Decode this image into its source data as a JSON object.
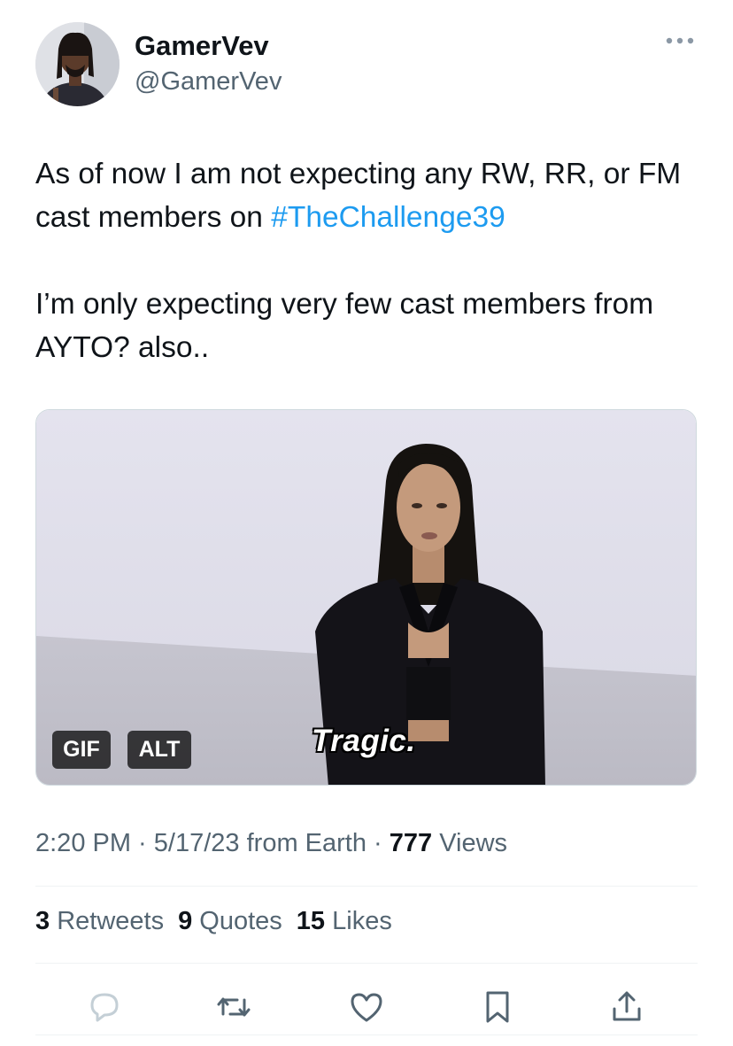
{
  "author": {
    "display_name": "GamerVev",
    "handle": "@GamerVev",
    "avatar_icon": "profile-photo"
  },
  "more_icon": "more-horizontal-icon",
  "tweet": {
    "line1_text": "As of now I am not expecting any RW, RR, or FM cast members on ",
    "hashtag": "#TheChallenge39",
    "paragraph2": "I’m only expecting very few cast members from AYTO? also.."
  },
  "media": {
    "gif_badge": "GIF",
    "alt_badge": "ALT",
    "caption": "Tragic."
  },
  "meta": {
    "time": "2:20 PM",
    "sep1": " · ",
    "date": "5/17/23",
    "source": " from Earth",
    "sep2": " · ",
    "views_count": "777",
    "views_label": " Views"
  },
  "stats": {
    "retweets_count": "3",
    "retweets_label": " Retweets",
    "quotes_count": "9",
    "quotes_label": " Quotes",
    "likes_count": "15",
    "likes_label": " Likes"
  },
  "actions": [
    "reply-icon",
    "retweet-icon",
    "like-icon",
    "bookmark-icon",
    "share-icon"
  ],
  "colors": {
    "accent": "#1d9bf0",
    "text": "#0f1419",
    "secondary": "#536471",
    "divider": "#eff3f4"
  }
}
